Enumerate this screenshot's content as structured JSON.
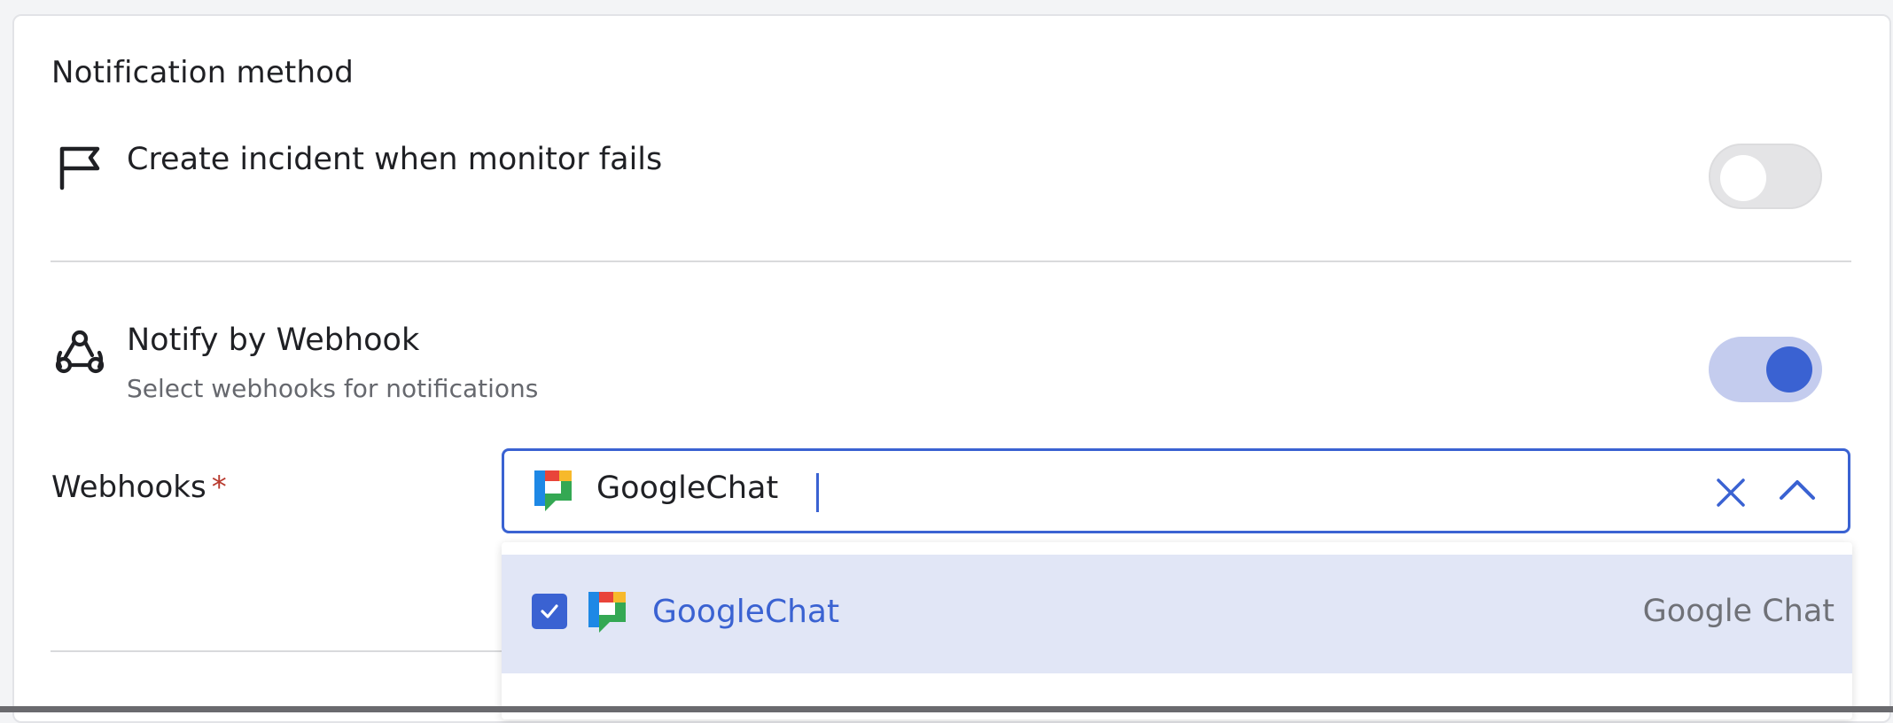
{
  "notification": {
    "section_title": "Notification method",
    "incident": {
      "icon": "flag-icon",
      "title": "Create incident when monitor fails",
      "enabled": false
    },
    "webhook": {
      "icon": "webhook-icon",
      "title": "Notify by Webhook",
      "subtitle": "Select webhooks for notifications",
      "enabled": true
    }
  },
  "webhooks_field": {
    "label": "Webhooks",
    "required_mark": "*",
    "selected": [
      {
        "icon": "google-chat-icon",
        "label": "GoogleChat"
      }
    ],
    "clear_icon": "close-icon",
    "toggle_icon": "chevron-up-icon",
    "options": [
      {
        "icon": "google-chat-icon",
        "label": "GoogleChat",
        "description": "Google Chat",
        "checked": true
      }
    ]
  },
  "colors": {
    "accent": "#3a62d2",
    "toggle_on_track": "#c4ccee",
    "option_highlight": "#e1e6f6",
    "required": "#b83a2e"
  }
}
